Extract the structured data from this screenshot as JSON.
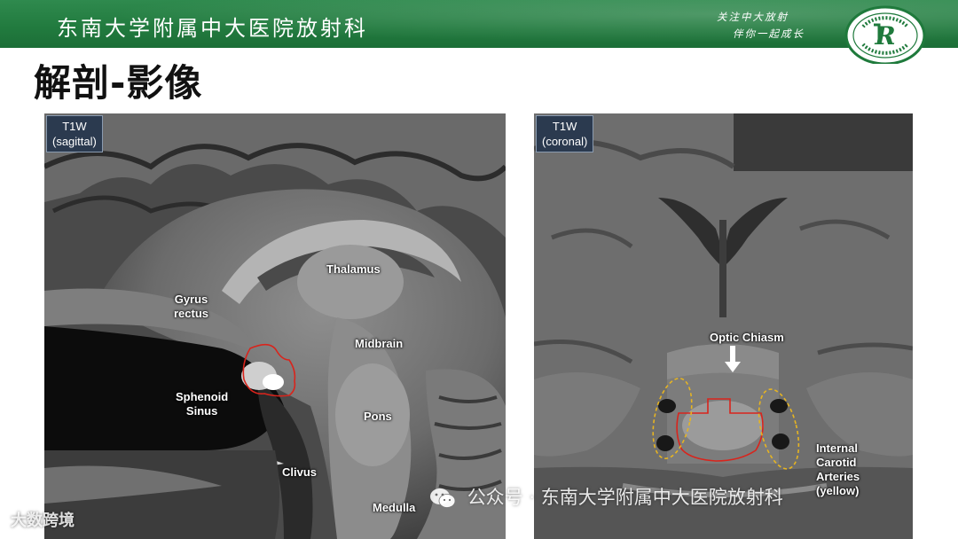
{
  "header": {
    "institution": "东南大学附属中大医院放射科",
    "slogan_line1": "关注中大放射",
    "slogan_line2": "伴你一起成长",
    "logo_letter": "R",
    "logo_ring_text": "东南大学附属中大医院放射科",
    "banner_color": "#217a3e"
  },
  "page": {
    "title": "解剖-影像"
  },
  "panels": {
    "left": {
      "sequence": "T1W",
      "plane": "(sagittal)",
      "labels": {
        "thalamus": "Thalamus",
        "gyrus_line1": "Gyrus",
        "gyrus_line2": "rectus",
        "midbrain": "Midbrain",
        "sphenoid_line1": "Sphenoid",
        "sphenoid_line2": "Sinus",
        "pons": "Pons",
        "clivus": "Clivus",
        "medulla": "Medulla"
      }
    },
    "right": {
      "sequence": "T1W",
      "plane": "(coronal)",
      "labels": {
        "optic_chiasm": "Optic Chiasm",
        "ica_line1": "Internal",
        "ica_line2": "Carotid",
        "ica_line3": "Arteries",
        "ica_line4": "(yellow)"
      }
    },
    "outline_colors": {
      "pituitary": "#d9241c",
      "carotid": "#e6b422"
    }
  },
  "watermarks": {
    "corner": "大数跨境",
    "center": "公众号 · 东南大学附属中大医院放射科"
  }
}
